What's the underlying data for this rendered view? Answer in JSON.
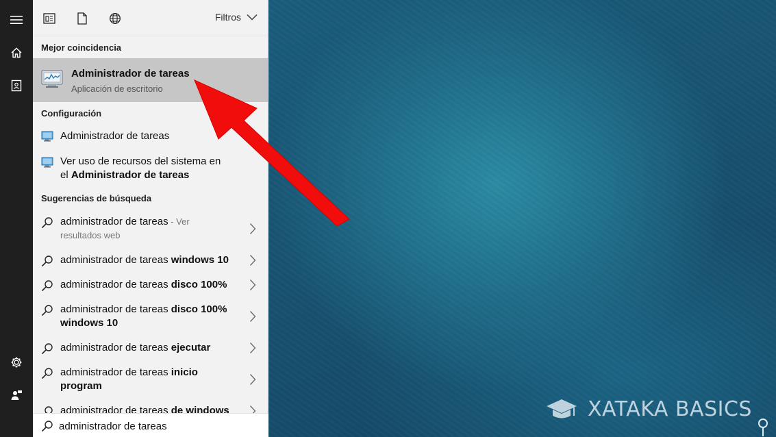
{
  "toolbar": {
    "filters_label": "Filtros"
  },
  "best_match": {
    "header": "Mejor coincidencia",
    "title": "Administrador de tareas",
    "subtitle": "Aplicación de escritorio"
  },
  "settings": {
    "header": "Configuración",
    "items": [
      {
        "label": "Administrador de tareas"
      },
      {
        "line1": "Ver uso de recursos del sistema en",
        "line2_prefix": "el ",
        "line2_bold": "Administrador de tareas"
      }
    ]
  },
  "suggestions": {
    "header": "Sugerencias de búsqueda",
    "items": [
      {
        "prefix": "administrador de tareas",
        "bold": "",
        "suffix": " - Ver",
        "line2": "resultados web"
      },
      {
        "prefix": "administrador de tareas ",
        "bold": "windows 10",
        "line2": ""
      },
      {
        "prefix": "administrador de tareas ",
        "bold": "disco 100%",
        "line2": ""
      },
      {
        "prefix": "administrador de tareas ",
        "bold": "disco 100%",
        "line2": "windows 10"
      },
      {
        "prefix": "administrador de tareas ",
        "bold": "ejecutar",
        "line2": ""
      },
      {
        "prefix": "administrador de tareas ",
        "bold": "inicio",
        "line2": "program"
      },
      {
        "prefix": "administrador de tareas ",
        "bold": "de windows",
        "line2": ""
      }
    ]
  },
  "search": {
    "value": "administrador de tareas"
  },
  "watermark": {
    "text": "XATAKA BASICS"
  },
  "icons": {
    "rail": [
      "hamburger-menu-icon",
      "home-icon",
      "notebook-icon",
      "settings-gear-icon",
      "feedback-person-icon"
    ],
    "toolbar": [
      "apps-filter-icon",
      "documents-filter-icon",
      "web-filter-icon"
    ]
  },
  "colors": {
    "rail_bg": "#1f1f1f",
    "panel_bg": "#f2f2f2",
    "selected_bg": "#c6c6c6",
    "arrow": "#f20d0d"
  }
}
